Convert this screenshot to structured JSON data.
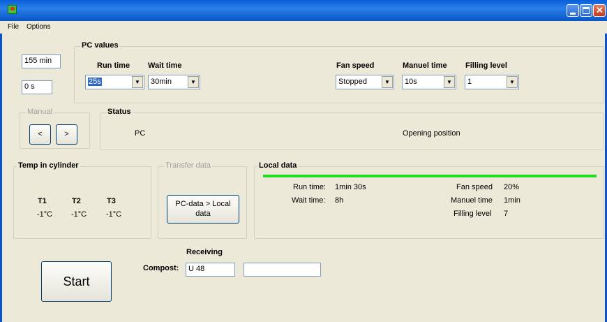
{
  "menu": {
    "file": "File",
    "options": "Options"
  },
  "counters": {
    "minutes": "155 min",
    "seconds": "0 s"
  },
  "pc_values": {
    "title": "PC values",
    "run_time": {
      "label": "Run time",
      "value": "25s"
    },
    "wait_time": {
      "label": "Wait time",
      "value": "30min"
    },
    "fan_speed": {
      "label": "Fan speed",
      "value": "Stopped"
    },
    "manuel_time": {
      "label": "Manuel time",
      "value": "10s"
    },
    "filling_level": {
      "label": "Filling level",
      "value": "1"
    }
  },
  "manual": {
    "title": "Manual",
    "prev": "<",
    "next": ">"
  },
  "status": {
    "title": "Status",
    "source": "PC",
    "position": "Opening position"
  },
  "temp": {
    "title": "Temp in cylinder",
    "sensors": [
      {
        "name": "T1",
        "value": "-1°C"
      },
      {
        "name": "T2",
        "value": "-1°C"
      },
      {
        "name": "T3",
        "value": "-1°C"
      }
    ]
  },
  "transfer": {
    "title": "Transfer data",
    "button": "PC-data > Local data"
  },
  "local_data": {
    "title": "Local data",
    "progress": 1.0,
    "run_time_label": "Run time:",
    "run_time_value": "1min 30s",
    "wait_time_label": "Wait time:",
    "wait_time_value": "8h",
    "fan_speed_label": "Fan speed",
    "fan_speed_value": "20%",
    "manuel_time_label": "Manuel time",
    "manuel_time_value": "1min",
    "filling_level_label": "Filling level",
    "filling_level_value": "7"
  },
  "receiving": {
    "title": "Receiving",
    "compost_label": "Compost:",
    "compost_value": "U 48",
    "extra_value": ""
  },
  "start_button": "Start",
  "colors": {
    "titlebar": "#0a5fd8",
    "progress": "#22dd22",
    "selection": "#316ac5"
  }
}
